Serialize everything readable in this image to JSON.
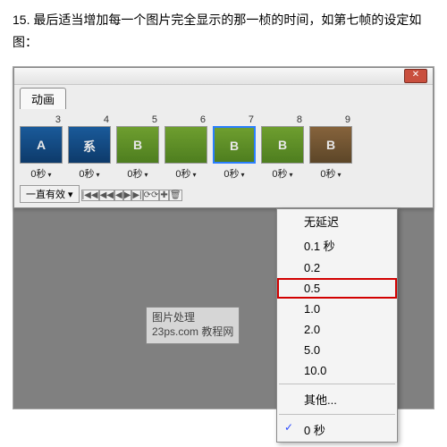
{
  "instruction": "15. 最后适当增加每一个图片完全显示的那一桢的时间，如第七帧的设定如图：",
  "panel": {
    "close_glyph": "✕",
    "tab_label": "动画",
    "loop_label": "一直有效 ▾",
    "buttons": [
      "|◀◀",
      "◀◀",
      "◀",
      "▶",
      "▶|",
      "⟳⟳",
      "✚",
      "🗑"
    ]
  },
  "frames": [
    {
      "num": "3",
      "delay": "0秒",
      "dd": "▾",
      "cls": "blue",
      "letter": "A",
      "sel": false
    },
    {
      "num": "4",
      "delay": "0秒",
      "dd": "▾",
      "cls": "blue",
      "letter": "系",
      "sel": false
    },
    {
      "num": "5",
      "delay": "0秒",
      "dd": "▾",
      "cls": "green",
      "letter": "B",
      "sel": false
    },
    {
      "num": "6",
      "delay": "0秒",
      "dd": "▾",
      "cls": "green",
      "letter": "",
      "sel": false
    },
    {
      "num": "7",
      "delay": "0秒",
      "dd": "▾",
      "cls": "green",
      "letter": "B",
      "sel": true
    },
    {
      "num": "8",
      "delay": "0秒",
      "dd": "▾",
      "cls": "green",
      "letter": "B",
      "sel": false
    },
    {
      "num": "9",
      "delay": "0秒",
      "dd": "▾",
      "cls": "brown",
      "letter": "B",
      "sel": false
    }
  ],
  "menu": [
    {
      "label": "无延迟",
      "hl": false,
      "sep": false,
      "chk": false
    },
    {
      "label": "0.1 秒",
      "hl": false,
      "sep": false,
      "chk": false
    },
    {
      "label": "0.2",
      "hl": false,
      "sep": false,
      "chk": false
    },
    {
      "label": "0.5",
      "hl": true,
      "sep": false,
      "chk": false
    },
    {
      "label": "1.0",
      "hl": false,
      "sep": false,
      "chk": false
    },
    {
      "label": "2.0",
      "hl": false,
      "sep": false,
      "chk": false
    },
    {
      "label": "5.0",
      "hl": false,
      "sep": false,
      "chk": false
    },
    {
      "label": "10.0",
      "hl": false,
      "sep": false,
      "chk": false
    },
    {
      "sep": true
    },
    {
      "label": "其他...",
      "hl": false,
      "sep": false,
      "chk": false
    },
    {
      "sep": true
    },
    {
      "label": "0 秒",
      "hl": false,
      "sep": false,
      "chk": true
    }
  ],
  "watermark": {
    "line1": "图片处理",
    "line2": "23ps.com 教程网"
  }
}
